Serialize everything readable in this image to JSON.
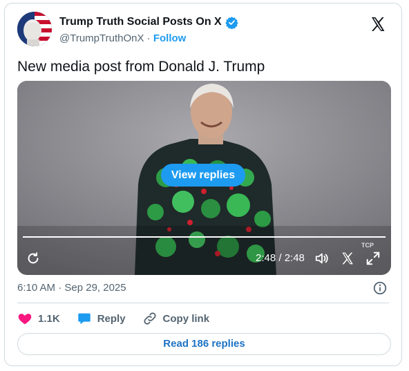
{
  "author": {
    "name": "Trump Truth Social Posts On X",
    "handle": "@TrumpTruthOnX",
    "separator": "·",
    "follow_label": "Follow"
  },
  "tweet": {
    "text": "New media post from Donald J. Trump",
    "timestamp": "6:10 AM · Sep 29, 2025"
  },
  "video": {
    "view_replies_label": "View replies",
    "time": "2:48 / 2:48",
    "watermark": "TCP",
    "progress": 1.0
  },
  "actions": {
    "like_count": "1.1K",
    "reply_label": "Reply",
    "copy_label": "Copy link"
  },
  "read_replies_label": "Read 186 replies",
  "colors": {
    "accent": "#1d9bf0",
    "like": "#f91880",
    "link": "#1d73c4",
    "border": "#cfd9de"
  },
  "icons": [
    "x-logo-icon",
    "verified-badge-icon",
    "replay-icon",
    "volume-icon",
    "expand-icon",
    "info-icon",
    "heart-icon",
    "reply-bubble-icon",
    "link-icon"
  ]
}
